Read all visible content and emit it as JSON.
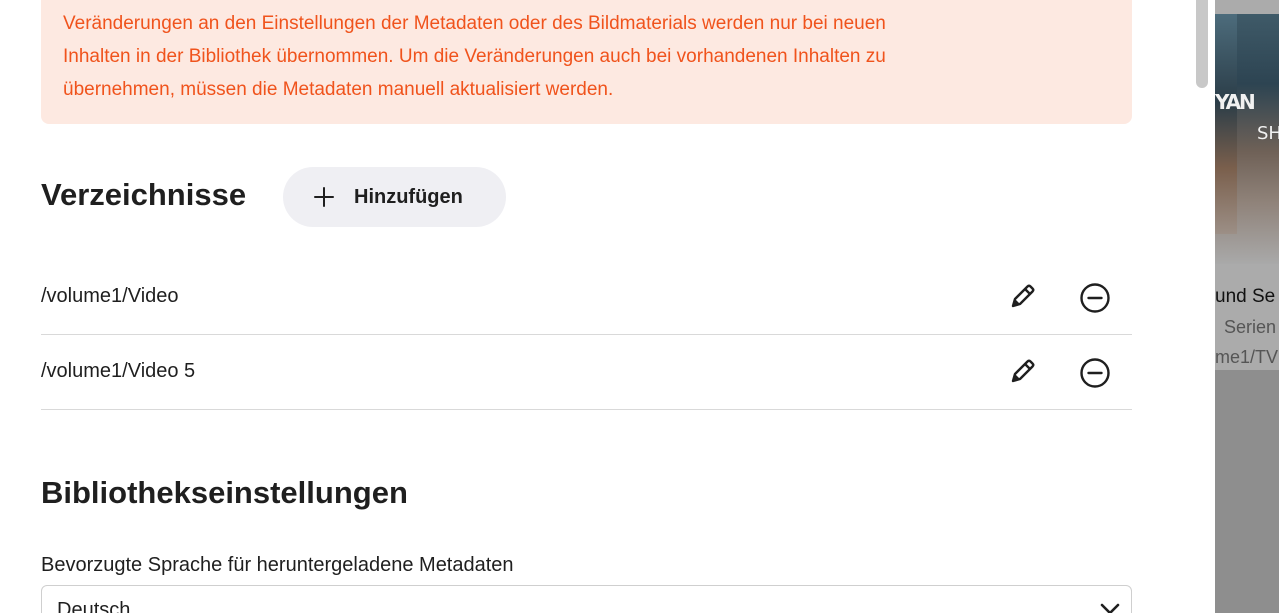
{
  "warning": {
    "line1": "Veränderungen an den Einstellungen der Metadaten oder des Bildmaterials werden nur bei neuen",
    "line2": "Inhalten in der Bibliothek übernommen. Um die Veränderungen auch bei vorhandenen Inhalten zu",
    "line3": "übernehmen, müssen die Metadaten manuell aktualisiert werden."
  },
  "directories": {
    "title": "Verzeichnisse",
    "add_label": "Hinzufügen",
    "items": [
      {
        "path": "/volume1/Video"
      },
      {
        "path": "/volume1/Video 5"
      }
    ]
  },
  "library_settings": {
    "title": "Bibliothekseinstellungen",
    "language_label": "Bevorzugte Sprache für heruntergeladene Metadaten",
    "language_value": "Deutsch"
  },
  "background_card": {
    "poster_text_1": "YAN",
    "poster_text_2": "SH",
    "title_fragment": "und Se",
    "subtitle_fragment": "Serien",
    "path_fragment": "me1/TV"
  },
  "colors": {
    "warning_text": "#f0531c",
    "warning_bg": "#fde9e1",
    "button_bg": "#efeff3"
  }
}
